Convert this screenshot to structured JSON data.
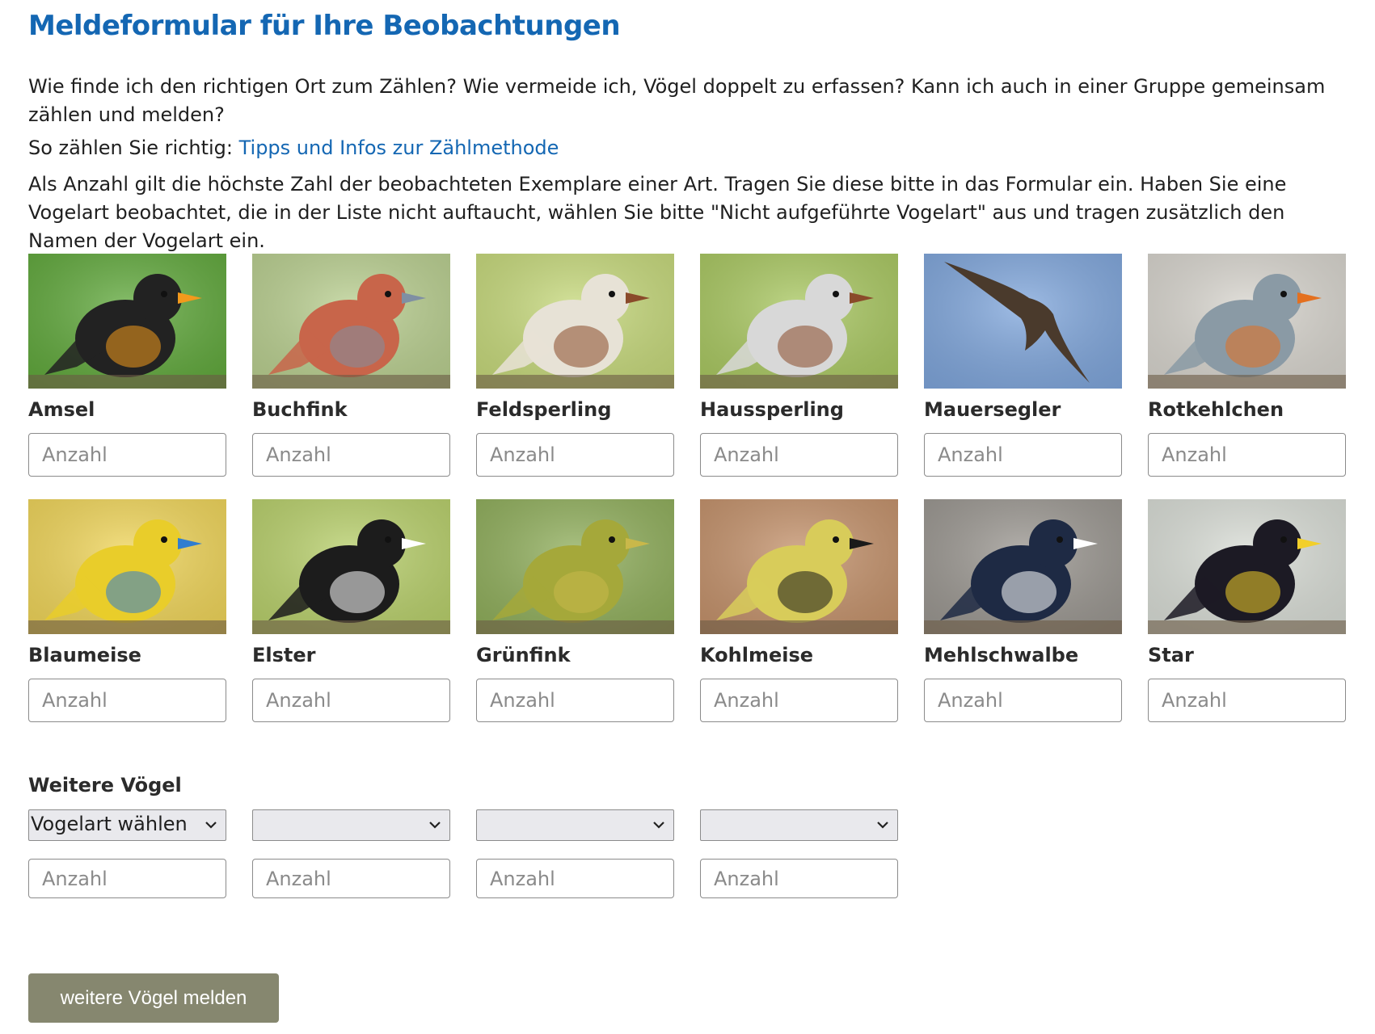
{
  "page": {
    "title": "Meldeformular für Ihre Beobachtungen",
    "intro": "Wie finde ich den richtigen Ort zum Zählen? Wie vermeide ich, Vögel doppelt zu erfassen? Kann ich auch in einer Gruppe gemeinsam zählen und melden?",
    "howto_prefix": "So zählen Sie richtig: ",
    "howto_link": "Tipps und Infos zur Zählmethode",
    "explanation": "Als Anzahl gilt die höchste Zahl der beobachteten Exemplare einer Art. Tragen Sie diese bitte in das Formular ein. Haben Sie eine Vogelart beobachtet, die in der Liste nicht auftaucht, wählen Sie bitte \"Nicht aufgeführte Vogelart\" aus und tragen zusätzlich den Namen der Vogelart ein."
  },
  "count_placeholder": "Anzahl",
  "birds": [
    {
      "name": "Amsel",
      "bg": "#5fa83a",
      "body": "#222222",
      "accent": "#f39a1c"
    },
    {
      "name": "Buchfink",
      "bg": "#b9cf8f",
      "body": "#c8654a",
      "accent": "#7f8fa3"
    },
    {
      "name": "Feldsperling",
      "bg": "#c6d97a",
      "body": "#e7e2d6",
      "accent": "#8a4a2a"
    },
    {
      "name": "Haussperling",
      "bg": "#a9c860",
      "body": "#d8d8d8",
      "accent": "#8a4a2a"
    },
    {
      "name": "Mauersegler",
      "bg": "#7fa6dc",
      "body": "#4a3a2c",
      "accent": "#4a3a2c"
    },
    {
      "name": "Rotkehlchen",
      "bg": "#d8d5ce",
      "body": "#8a9aa5",
      "accent": "#e4701f"
    },
    {
      "name": "Blaumeise",
      "bg": "#f0d558",
      "body": "#e9cd2a",
      "accent": "#2f7dd0"
    },
    {
      "name": "Elster",
      "bg": "#b8d06a",
      "body": "#1c1c1c",
      "accent": "#ffffff"
    },
    {
      "name": "Grünfink",
      "bg": "#8fae5a",
      "body": "#a5a83a",
      "accent": "#c9b84a"
    },
    {
      "name": "Kohlmeise",
      "bg": "#c4916a",
      "body": "#d8cc5a",
      "accent": "#1a1a1a"
    },
    {
      "name": "Mehlschwalbe",
      "bg": "#9a9690",
      "body": "#1e2a44",
      "accent": "#ffffff"
    },
    {
      "name": "Star",
      "bg": "#d9ddd6",
      "body": "#1c1a24",
      "accent": "#f2cf2a"
    }
  ],
  "more_birds": {
    "title": "Weitere Vögel",
    "select_default": "Vogelart wählen",
    "selects": [
      "Vogelart wählen",
      "",
      "",
      ""
    ]
  },
  "submit_label": "weitere Vögel melden",
  "colors": {
    "title": "#1467b3",
    "link": "#1467b3",
    "button": "#86876f"
  }
}
